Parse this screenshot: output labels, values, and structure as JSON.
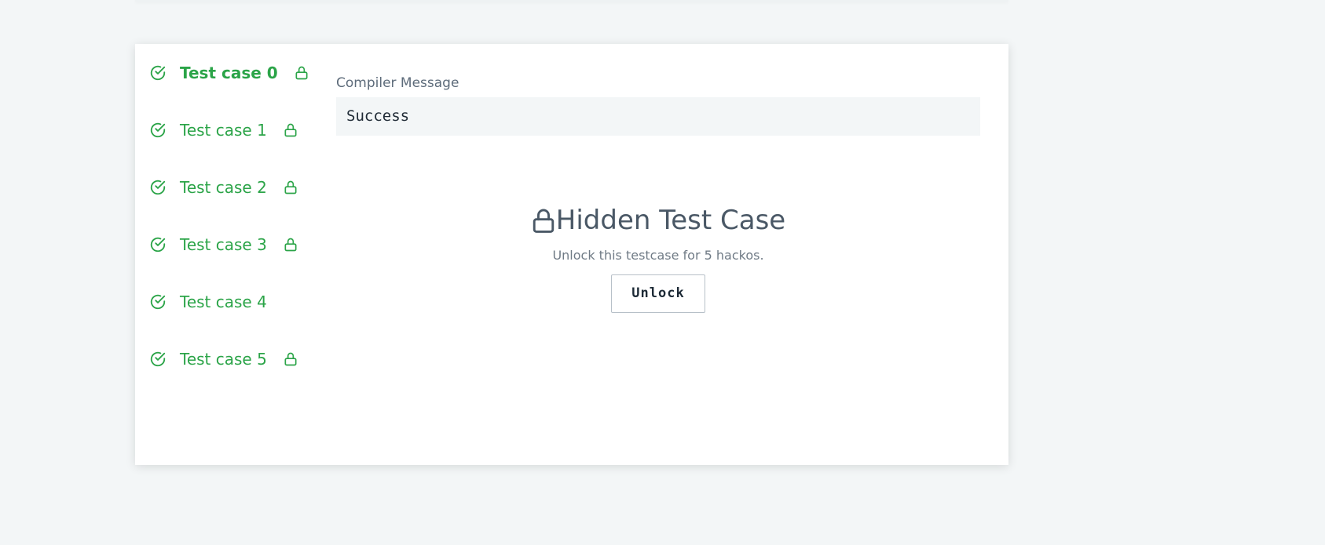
{
  "test_cases": [
    {
      "label": "Test case 0",
      "status_icon": "check-circle-icon",
      "locked": true,
      "active": true
    },
    {
      "label": "Test case 1",
      "status_icon": "check-circle-icon",
      "locked": true,
      "active": false
    },
    {
      "label": "Test case 2",
      "status_icon": "check-circle-icon",
      "locked": true,
      "active": false
    },
    {
      "label": "Test case 3",
      "status_icon": "check-circle-icon",
      "locked": true,
      "active": false
    },
    {
      "label": "Test case 4",
      "status_icon": "check-circle-icon",
      "locked": false,
      "active": false
    },
    {
      "label": "Test case 5",
      "status_icon": "check-circle-icon",
      "locked": true,
      "active": false
    }
  ],
  "compiler": {
    "title": "Compiler Message",
    "message": "Success"
  },
  "hidden": {
    "icon": "lock-icon",
    "title": "Hidden Test Case",
    "subtitle": "Unlock this testcase for 5 hackos.",
    "button_label": "Unlock"
  },
  "colors": {
    "success_green": "#2ba448",
    "page_bg": "#f3f6f7",
    "panel_bg": "#ffffff",
    "heading_gray": "#4a5866",
    "muted_gray": "#707b86"
  }
}
